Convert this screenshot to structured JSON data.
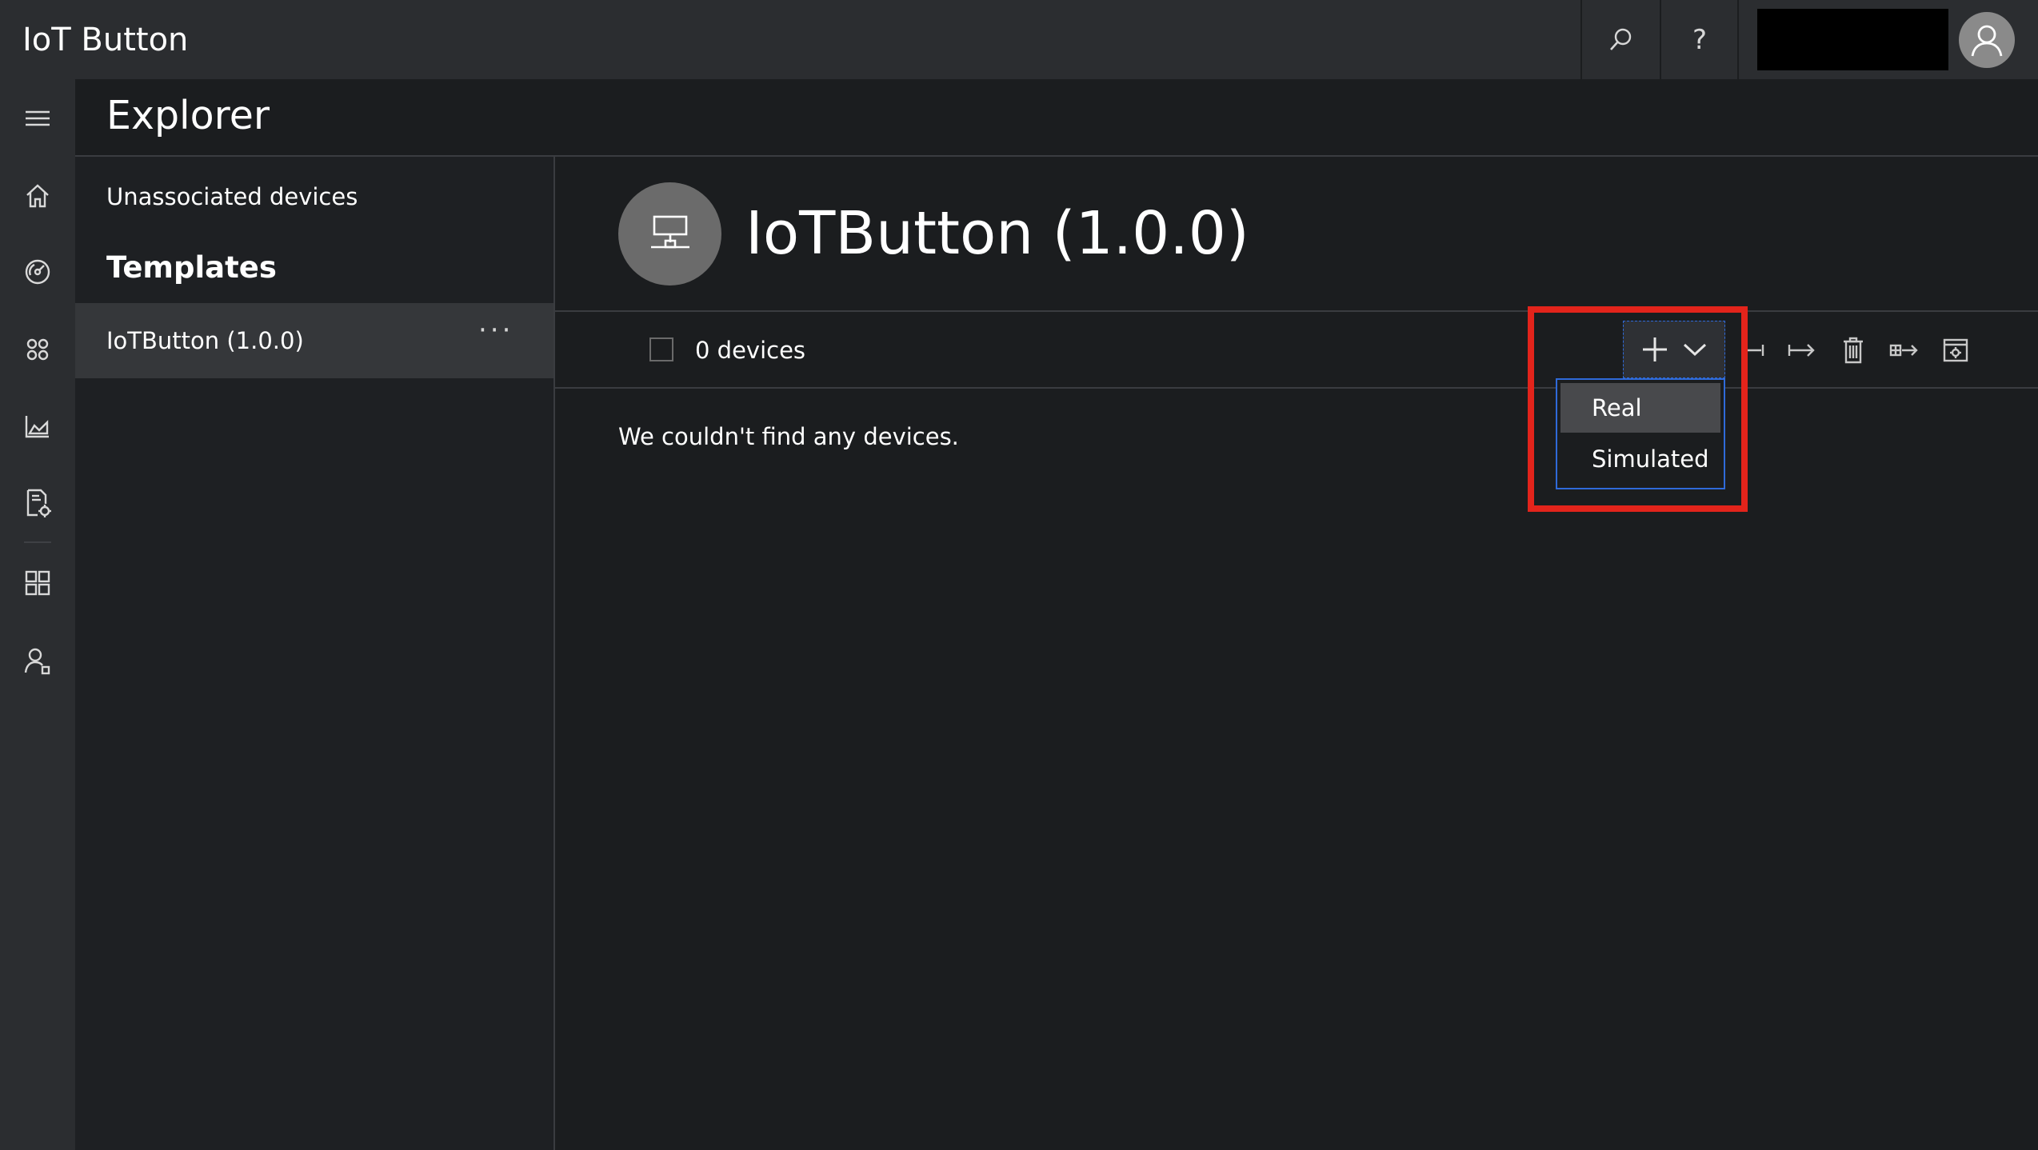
{
  "app": {
    "title": "IoT Button"
  },
  "topbar": {
    "search_icon": "search-icon",
    "help_label": "?",
    "avatar_icon": "user-avatar-icon"
  },
  "nav": {
    "items": [
      {
        "icon": "hamburger-menu-icon"
      },
      {
        "icon": "home-icon"
      },
      {
        "icon": "dashboard-gauge-icon"
      },
      {
        "icon": "device-explorer-icon"
      },
      {
        "icon": "analytics-chart-icon"
      },
      {
        "icon": "jobs-document-gear-icon"
      },
      {
        "icon": "app-builder-grid-icon"
      },
      {
        "icon": "administration-user-icon"
      }
    ]
  },
  "explorer": {
    "title": "Explorer",
    "unassociated_label": "Unassociated devices",
    "templates_heading": "Templates",
    "templates": [
      {
        "label": "IoTButton (1.0.0)",
        "more": "···"
      }
    ]
  },
  "main": {
    "template_title": "IoTButton (1.0.0)",
    "device_count": "0 devices",
    "empty_message": "We couldn't find any devices."
  },
  "toolbar": {
    "add_icon": "plus-icon",
    "dropdown_icon": "chevron-down-icon",
    "tools": [
      "connect-icon",
      "move-to-template-icon",
      "delete-icon",
      "migrate-icon",
      "settings-icon"
    ]
  },
  "dropdown": {
    "options": [
      "Real",
      "Simulated"
    ],
    "highlighted": "Real"
  },
  "colors": {
    "annotation": "#e3241b",
    "focus": "#2f6ad9",
    "background": "#1b1d1f",
    "chrome": "#2b2d30"
  }
}
